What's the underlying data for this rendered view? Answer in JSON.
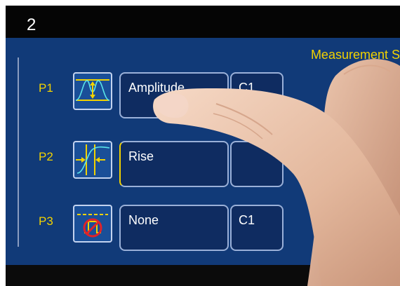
{
  "step": "2",
  "panel": {
    "title": "Measurement S"
  },
  "rows": [
    {
      "label": "P1",
      "icon": "amplitude-icon",
      "measurement": "Amplitude",
      "source": "C1"
    },
    {
      "label": "P2",
      "icon": "rise-time-icon",
      "measurement": "Rise",
      "source": ""
    },
    {
      "label": "P3",
      "icon": "none-icon",
      "measurement": "None",
      "source": "C1"
    }
  ],
  "colors": {
    "accent": "#f2d200",
    "screen": "#113a78",
    "button": "#1a4f98",
    "field": "#0f2c61"
  }
}
